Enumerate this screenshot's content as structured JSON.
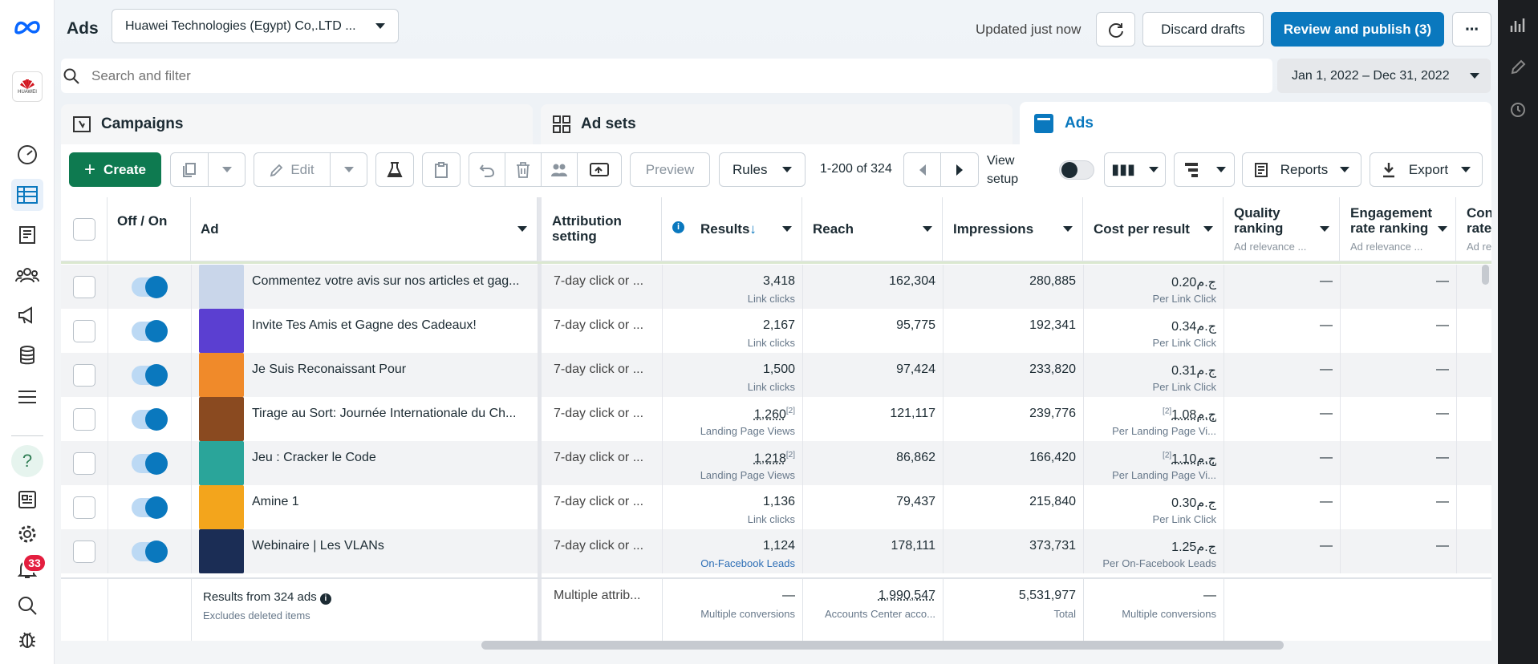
{
  "app": {
    "title": "Ads",
    "account": "Huawei Technologies (Egypt) Co,.LTD ...",
    "updated": "Updated just now",
    "discard": "Discard drafts",
    "review": "Review and publish (3)",
    "more": "⋯"
  },
  "search": {
    "placeholder": "Search and filter",
    "date_range": "Jan 1, 2022 – Dec 31, 2022"
  },
  "tabs": {
    "campaigns": "Campaigns",
    "adsets": "Ad sets",
    "ads": "Ads"
  },
  "toolbar": {
    "create": "Create",
    "edit": "Edit",
    "preview": "Preview",
    "rules": "Rules",
    "pagination": "1-200 of 324",
    "view_setup": "View setup",
    "reports": "Reports",
    "export": "Export"
  },
  "columns": {
    "offon": "Off / On",
    "ad": "Ad",
    "attribution": "Attribution setting",
    "results": "Results",
    "reach": "Reach",
    "impressions": "Impressions",
    "cpr": "Cost per result",
    "quality": "Quality ranking",
    "quality_sub": "Ad relevance ...",
    "engagement": "Engagement rate ranking",
    "engagement_sub": "Ad relevance ...",
    "conv": "Conv rate",
    "conv_sub": "Ad re"
  },
  "rows": [
    {
      "name": "Commentez votre avis sur nos articles et gag...",
      "attr": "7-day click or ...",
      "results": "3,418",
      "results_sub": "Link clicks",
      "reach": "162,304",
      "impr": "280,885",
      "cpr": "ج.م0.20",
      "cpr_sub": "Per Link Click",
      "quality": "—",
      "engagement": "—",
      "thumb": "#c9d6ea"
    },
    {
      "name": "Invite Tes Amis et Gagne des Cadeaux!",
      "attr": "7-day click or ...",
      "results": "2,167",
      "results_sub": "Link clicks",
      "reach": "95,775",
      "impr": "192,341",
      "cpr": "ج.م0.34",
      "cpr_sub": "Per Link Click",
      "quality": "—",
      "engagement": "—",
      "thumb": "#5b3fd1"
    },
    {
      "name": "Je Suis Reconaissant Pour",
      "attr": "7-day click or ...",
      "results": "1,500",
      "results_sub": "Link clicks",
      "reach": "97,424",
      "impr": "233,820",
      "cpr": "ج.م0.31",
      "cpr_sub": "Per Link Click",
      "quality": "—",
      "engagement": "—",
      "thumb": "#f08a2a"
    },
    {
      "name": "Tirage au Sort: Journée Internationale du Ch...",
      "attr": "7-day click or ...",
      "results": "1,260",
      "results_mark": "[2]",
      "results_sub": "Landing Page Views",
      "reach": "121,117",
      "impr": "239,776",
      "cpr": "ج.م1.08",
      "cpr_mark": "[2]",
      "cpr_sub": "Per Landing Page Vi...",
      "quality": "—",
      "engagement": "—",
      "thumb": "#8a4a20"
    },
    {
      "name": "Jeu : Cracker le Code",
      "attr": "7-day click or ...",
      "results": "1,218",
      "results_mark": "[2]",
      "results_sub": "Landing Page Views",
      "reach": "86,862",
      "impr": "166,420",
      "cpr": "ج.م1.10",
      "cpr_mark": "[2]",
      "cpr_sub": "Per Landing Page Vi...",
      "quality": "—",
      "engagement": "—",
      "thumb": "#2aa59a"
    },
    {
      "name": "Amine 1",
      "attr": "7-day click or ...",
      "results": "1,136",
      "results_sub": "Link clicks",
      "reach": "79,437",
      "impr": "215,840",
      "cpr": "ج.م0.30",
      "cpr_sub": "Per Link Click",
      "quality": "—",
      "engagement": "—",
      "thumb": "#f3a51c"
    },
    {
      "name": "Webinaire | Les VLANs",
      "attr": "7-day click or ...",
      "results": "1,124",
      "results_sub": "On-Facebook Leads",
      "reach": "178,111",
      "impr": "373,731",
      "cpr": "ج.م1.25",
      "cpr_sub": "Per On-Facebook Leads",
      "quality": "—",
      "engagement": "—",
      "thumb": "#1b2d55"
    }
  ],
  "summary": {
    "title": "Results from 324 ads",
    "sub": "Excludes deleted items",
    "attr": "Multiple attrib...",
    "results": "—",
    "results_sub": "Multiple conversions",
    "reach": "1,990,547",
    "reach_sub": "Accounts Center acco...",
    "impr": "5,531,977",
    "impr_sub": "Total",
    "cpr": "—",
    "cpr_sub": "Multiple conversions"
  },
  "sidebar": {
    "notifications": "33",
    "logo": "HUAWEI"
  }
}
